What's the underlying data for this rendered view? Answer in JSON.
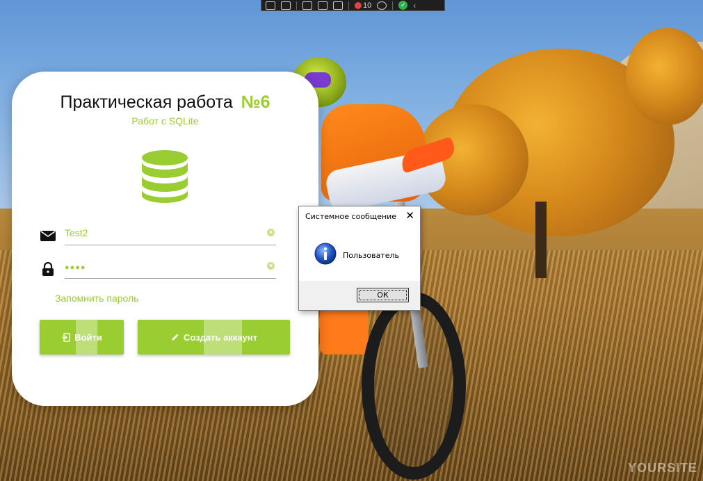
{
  "app": {
    "title_main": "Практическая работа",
    "title_number": "№6",
    "subtitle": "Работ с SQLite",
    "accent_color": "#9acd32",
    "db_icon": "database-icon"
  },
  "form": {
    "login": {
      "icon": "email-icon",
      "value": "Test2"
    },
    "password": {
      "icon": "lock-icon",
      "value": "●●●●"
    },
    "remember_label": "Запомнить пароль",
    "login_button": {
      "icon": "sign-in-icon",
      "label": "Войти"
    },
    "register_button": {
      "icon": "pencil-icon",
      "label": "Создать аккаунт"
    }
  },
  "dialog": {
    "title": "Системное сообщение",
    "close_glyph": "✕",
    "icon": "info-icon",
    "message": "Пользователь",
    "ok_label": "ОК"
  },
  "toolbar": {
    "counter": "10",
    "icons": [
      "select-icon",
      "video-icon",
      "pointer-icon",
      "frame-icon",
      "touch-icon",
      "counter-icon",
      "accessibility-icon",
      "check-icon",
      "chevron-left-icon"
    ]
  },
  "watermark": "YOURSITE"
}
